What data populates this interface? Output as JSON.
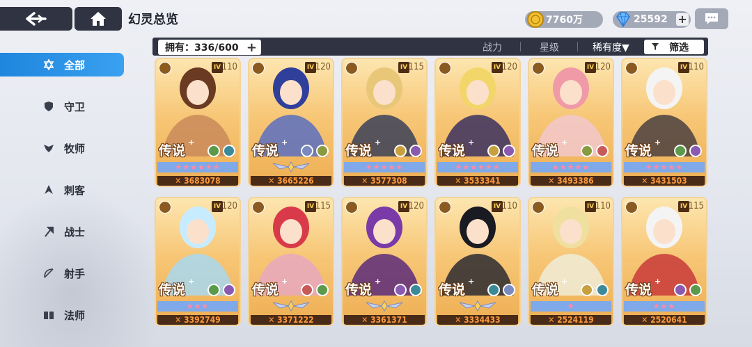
{
  "header": {
    "title": "幻灵总览",
    "gold": "7760万",
    "gems": "25592",
    "gold_plus": "",
    "gem_plus": "+"
  },
  "sidebar": {
    "items": [
      {
        "label": "全部",
        "icon": "star-of-david-icon",
        "active": true
      },
      {
        "label": "守卫",
        "icon": "shield-icon",
        "active": false
      },
      {
        "label": "牧师",
        "icon": "wings-icon",
        "active": false
      },
      {
        "label": "刺客",
        "icon": "assassin-icon",
        "active": false
      },
      {
        "label": "战士",
        "icon": "axe-icon",
        "active": false
      },
      {
        "label": "射手",
        "icon": "bow-icon",
        "active": false
      },
      {
        "label": "法师",
        "icon": "book-icon",
        "active": false
      }
    ]
  },
  "filterbar": {
    "owned": "拥有：336/600",
    "owned_plus": "+",
    "sort_power": "战力",
    "sort_star": "星级",
    "sort_rarity": "稀有度▼",
    "filter": "筛选"
  },
  "cards": [
    {
      "tier": "IV",
      "level": "110",
      "rarity": "传说",
      "stars": "★★★★★★",
      "power": "3683078",
      "art_color": "#c98a5a",
      "hair": "#6a3a22"
    },
    {
      "tier": "IV",
      "level": "120",
      "rarity": "传说",
      "stars": "",
      "power": "3665226",
      "art_color": "#5a6ec0",
      "hair": "#2f3f9a"
    },
    {
      "tier": "IV",
      "level": "115",
      "rarity": "传说",
      "stars": "★★★★★",
      "power": "3577308",
      "art_color": "#3a3f58",
      "hair": "#e8c878"
    },
    {
      "tier": "IV",
      "level": "120",
      "rarity": "传说",
      "stars": "★★★★★★",
      "power": "3533341",
      "art_color": "#3a3060",
      "hair": "#f2d66a"
    },
    {
      "tier": "IV",
      "level": "120",
      "rarity": "传说",
      "stars": "★★★★★",
      "power": "3493386",
      "art_color": "#f2c8cc",
      "hair": "#f09aa8"
    },
    {
      "tier": "IV",
      "level": "110",
      "rarity": "传说",
      "stars": "★★★★★",
      "power": "3431503",
      "art_color": "#4a4040",
      "hair": "#f4f4f4"
    },
    {
      "tier": "IV",
      "level": "120",
      "rarity": "传说",
      "stars": "★★★",
      "power": "3392749",
      "art_color": "#a8d8f0",
      "hair": "#c8ecff"
    },
    {
      "tier": "IV",
      "level": "115",
      "rarity": "传说",
      "stars": "",
      "power": "3371222",
      "art_color": "#e8a8c0",
      "hair": "#d83a4a"
    },
    {
      "tier": "IV",
      "level": "120",
      "rarity": "传说",
      "stars": "",
      "power": "3361371",
      "art_color": "#5a2a7a",
      "hair": "#7a3aa8"
    },
    {
      "tier": "IV",
      "level": "110",
      "rarity": "传说",
      "stars": "",
      "power": "3334433",
      "art_color": "#2a2a30",
      "hair": "#1a1a22"
    },
    {
      "tier": "IV",
      "level": "110",
      "rarity": "传说",
      "stars": "★",
      "power": "2524119",
      "art_color": "#f0ecd8",
      "hair": "#f0e0a0"
    },
    {
      "tier": "IV",
      "level": "115",
      "rarity": "传说",
      "stars": "★★★",
      "power": "2520641",
      "art_color": "#c83a3a",
      "hair": "#f4f4f4"
    }
  ],
  "colors": {
    "accent": "#1f86de",
    "dark_bar": "#2f3342",
    "card_gold": "#f7c777",
    "power_text": "#ff9a3a"
  }
}
